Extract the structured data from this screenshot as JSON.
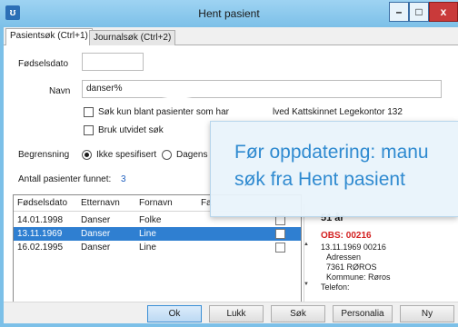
{
  "window": {
    "title": "Hent pasient",
    "controls": {
      "minimize": "–",
      "maximize": "□",
      "close": "x"
    }
  },
  "tabs": [
    {
      "label": "Pasientsøk (Ctrl+1)"
    },
    {
      "label": "Journalsøk (Ctrl+2)"
    }
  ],
  "form": {
    "fodselsdato_label": "Fødselsdato",
    "fodselsdato_value": "",
    "navn_label": "Navn",
    "navn_value": "danser%",
    "checkbox_kun_blant": "Søk kun blant pasienter som har",
    "checkbox_utvidet": "Bruk utvidet søk",
    "legekontor_text": "lved Kattskinnet Legekontor 132",
    "begrensning_label": "Begrensning",
    "radio_ikke_spesifisert": "Ikke spesifisert",
    "radio_dagens": "Dagens",
    "antall_label": "Antall pasienter funnet:",
    "antall_value": "3"
  },
  "results": {
    "columns": [
      "Fødselsdato",
      "Etternavn",
      "Fornavn",
      "Fa"
    ],
    "rows": [
      {
        "fodselsdato": "14.01.1998",
        "etternavn": "Danser",
        "fornavn": "Folke",
        "selected": false
      },
      {
        "fodselsdato": "13.11.1969",
        "etternavn": "Danser",
        "fornavn": "Line",
        "selected": true
      },
      {
        "fodselsdato": "16.02.1995",
        "etternavn": "Danser",
        "fornavn": "Line",
        "selected": false
      }
    ]
  },
  "detail": {
    "age": "51 år",
    "obs": "OBS: 00216",
    "id_line": "13.11.1969 00216",
    "address": "Adressen",
    "postal": "7361 RØROS",
    "kommune": "Kommune: Røros",
    "telefon": "Telefon:"
  },
  "buttons": {
    "ok": "Ok",
    "lukk": "Lukk",
    "sok": "Søk",
    "personalia": "Personalia",
    "ny": "Ny"
  },
  "callout": {
    "line1": "Før oppdatering: manu",
    "line2": "søk fra Hent pasient"
  },
  "colors": {
    "titlebar": "#7cc0e8",
    "selection": "#2f7fd1",
    "obs_red": "#d32020",
    "callout_text": "#2f8ad0"
  }
}
